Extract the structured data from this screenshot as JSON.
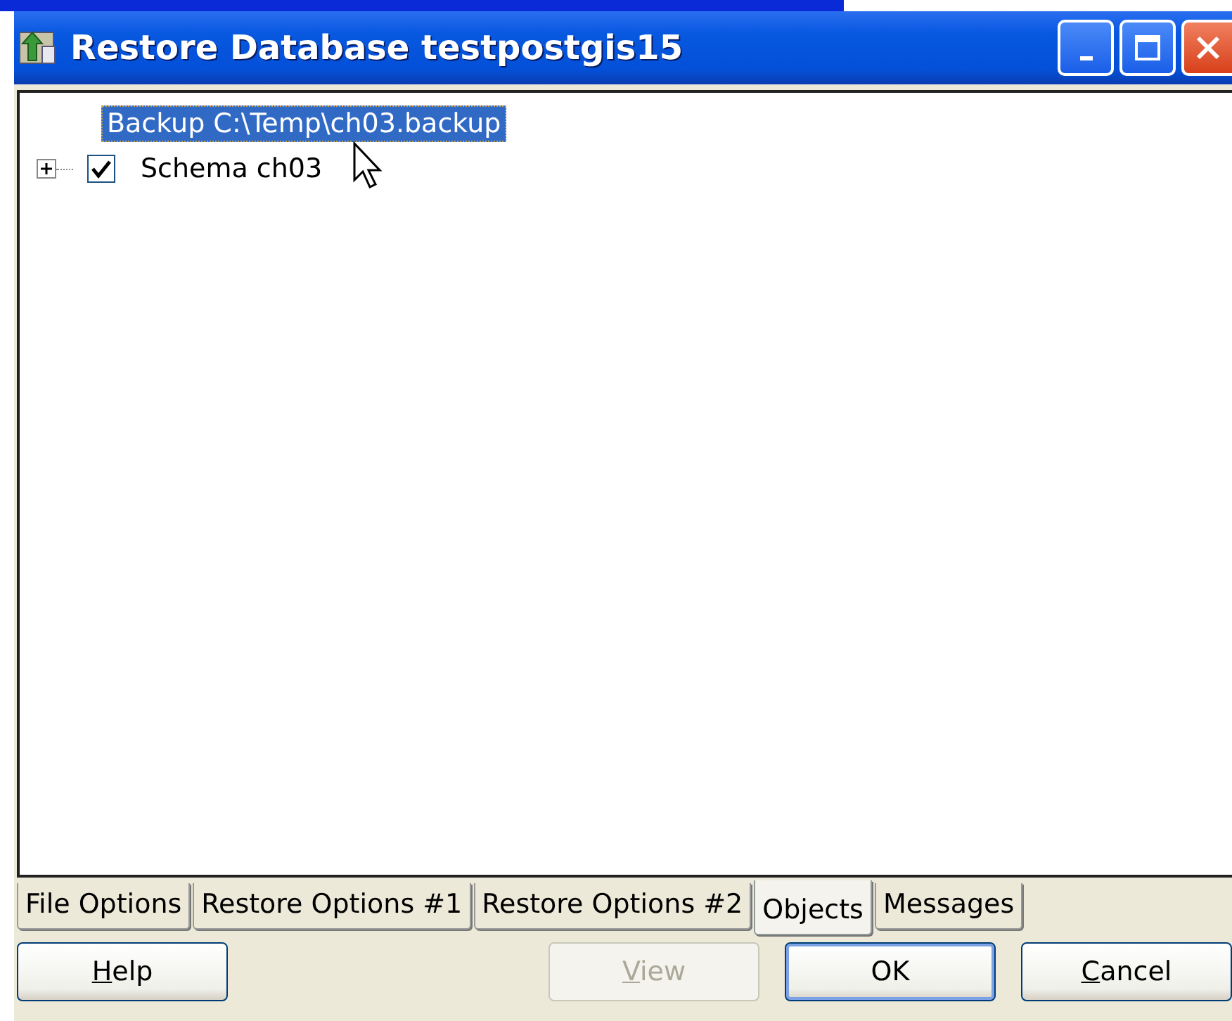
{
  "window": {
    "title": "Restore Database testpostgis15"
  },
  "tree": {
    "items": [
      {
        "label": "Backup C:\\Temp\\ch03.backup",
        "selected": true,
        "expandable": false
      },
      {
        "label": "Schema ch03",
        "selected": false,
        "expandable": true,
        "checked": true
      }
    ]
  },
  "tabs": [
    {
      "label": "File Options",
      "selected": false
    },
    {
      "label": "Restore Options #1",
      "selected": false
    },
    {
      "label": "Restore Options #2",
      "selected": false
    },
    {
      "label": "Objects",
      "selected": true
    },
    {
      "label": "Messages",
      "selected": false
    }
  ],
  "buttons": [
    {
      "access_key": "H",
      "label_rest": "elp",
      "disabled": false,
      "default": false
    },
    {
      "access_key": "V",
      "label_rest": "iew",
      "disabled": true,
      "default": false
    },
    {
      "label_rest": "OK",
      "disabled": false,
      "default": true
    },
    {
      "access_key": "C",
      "label_rest": "ancel",
      "disabled": false,
      "default": false
    }
  ]
}
